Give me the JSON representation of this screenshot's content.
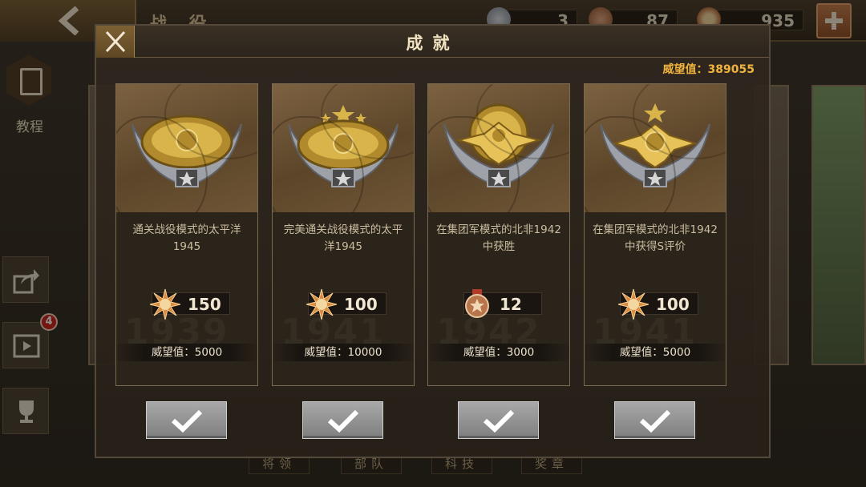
{
  "topbar": {
    "title": "战 役",
    "resources": {
      "silver_medals": "3",
      "bronze_medals": "87",
      "prestige_points": "935"
    }
  },
  "sidebar": {
    "tutorial_label": "教程",
    "video_badge": "4"
  },
  "bottom_tabs": [
    "将领",
    "部队",
    "科技",
    "奖章"
  ],
  "modal": {
    "title": "成就",
    "prestige_total": "威望值：389055",
    "achievements": [
      {
        "description": "通关战役模式的太平洋1945",
        "reward_icon": "prestige-sun-icon",
        "reward_value": "150",
        "prestige": "威望值：5000",
        "year": "1939"
      },
      {
        "description": "完美通关战役模式的太平洋1945",
        "reward_icon": "prestige-sun-icon",
        "reward_value": "100",
        "prestige": "威望值：10000",
        "year": "1941"
      },
      {
        "description": "在集团军模式的北非1942中获胜",
        "reward_icon": "bronze-medal-icon",
        "reward_value": "12",
        "prestige": "威望值：3000",
        "year": "1942"
      },
      {
        "description": "在集团军模式的北非1942中获得S评价",
        "reward_icon": "prestige-sun-icon",
        "reward_value": "100",
        "prestige": "威望值：5000",
        "year": "1941"
      }
    ]
  },
  "colors": {
    "accent_gold": "#f0b33d",
    "button_gray": "#9a9a9a",
    "panel": "#2b241b"
  }
}
